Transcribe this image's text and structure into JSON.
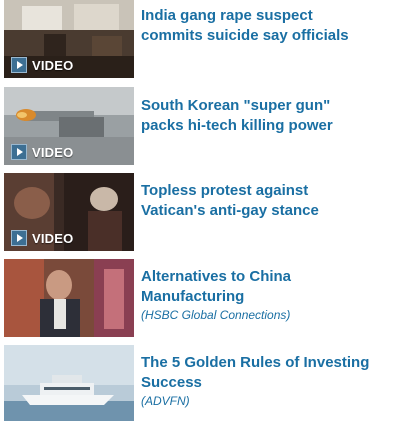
{
  "items": [
    {
      "headline_line1": "India gang rape suspect",
      "headline_line2": "commits suicide say officials",
      "badge": "VIDEO",
      "source": ""
    },
    {
      "headline_line1": "South Korean \"super gun\"",
      "headline_line2": "packs hi-tech killing power",
      "badge": "VIDEO",
      "source": ""
    },
    {
      "headline_line1": "Topless protest against",
      "headline_line2": "Vatican's anti-gay stance",
      "badge": "VIDEO",
      "source": ""
    },
    {
      "headline_line1": "Alternatives to China",
      "headline_line2": "Manufacturing",
      "badge": "",
      "source": "(HSBC Global Connections)"
    },
    {
      "headline_line1": "The 5 Golden Rules of Investing",
      "headline_line2": "Success",
      "badge": "",
      "source": "(ADVFN)"
    }
  ],
  "colors": {
    "link": "#1a6fa3",
    "badge_icon_bg": "#3d6f93",
    "text_on_thumb": "#ffffff"
  },
  "icons": {
    "badge_icon": "play-icon"
  }
}
